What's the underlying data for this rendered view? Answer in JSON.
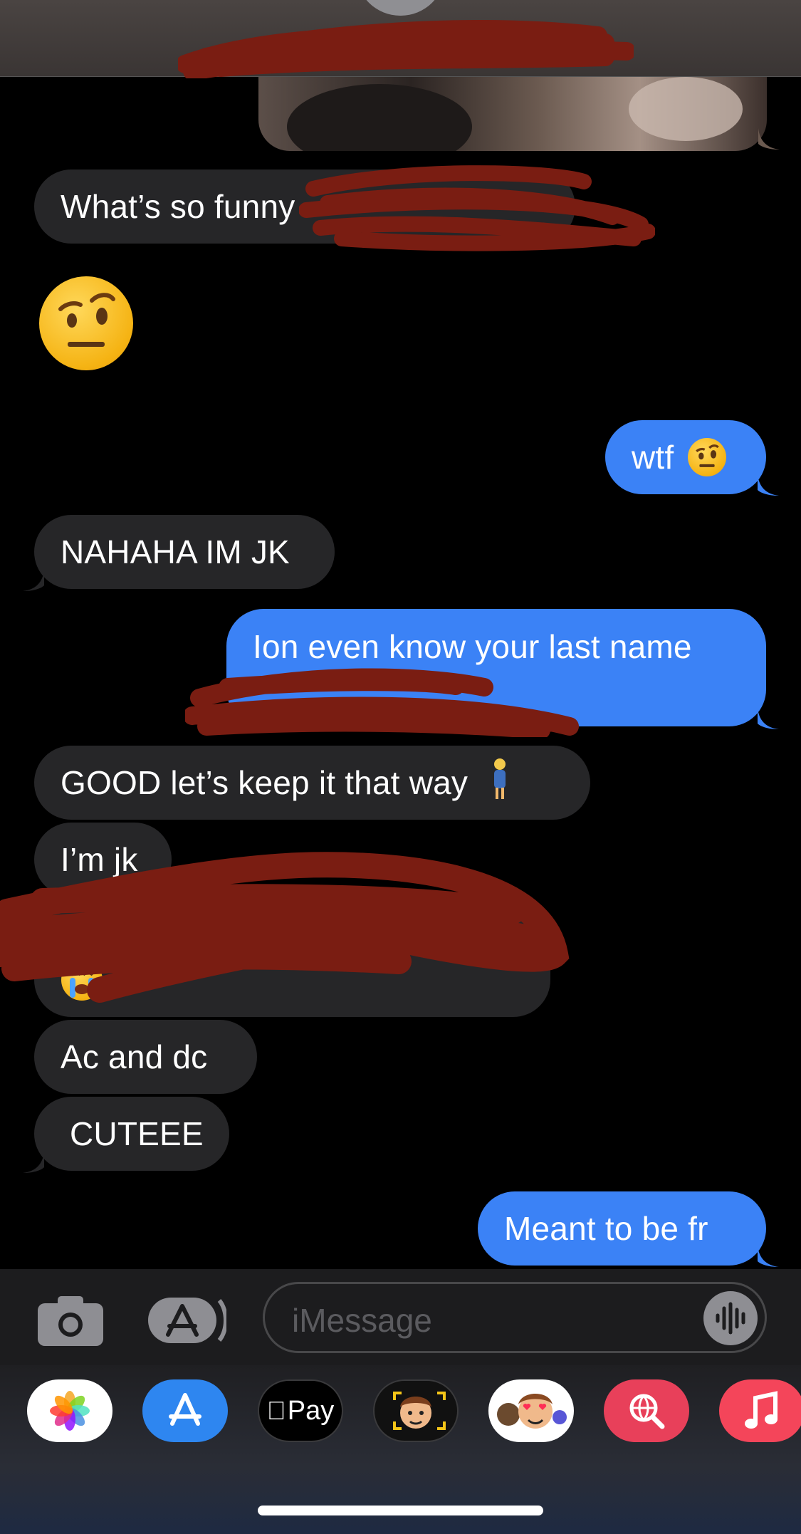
{
  "conversation": {
    "messages": [
      {
        "id": "m1",
        "direction": "incoming",
        "text": "What’s so funny"
      },
      {
        "id": "m3",
        "direction": "outgoing",
        "text": "wtf"
      },
      {
        "id": "m4",
        "direction": "incoming",
        "text": "NAHAHA IM JK"
      },
      {
        "id": "m5",
        "direction": "outgoing",
        "text": "Ion even know your last name"
      },
      {
        "id": "m6",
        "direction": "incoming",
        "text": "GOOD let’s keep it that way"
      },
      {
        "id": "m7",
        "direction": "incoming",
        "text": "I’m jk"
      },
      {
        "id": "m9",
        "direction": "incoming",
        "text": "Ac and dc"
      },
      {
        "id": "m10",
        "direction": "incoming",
        "text": "CUTEEE"
      },
      {
        "id": "m11",
        "direction": "outgoing",
        "text": "Meant to be fr"
      }
    ]
  },
  "icons": {
    "raised_eyebrow_emoji": "face-with-raised-eyebrow",
    "person_emoji": "woman-standing",
    "crying_emoji": "loudly-crying-face"
  },
  "composer": {
    "placeholder": "iMessage",
    "camera_icon": "camera-icon",
    "apps_icon": "app-store-icon",
    "audio_icon": "waveform-icon"
  },
  "app_strip": {
    "items": [
      {
        "name": "photos",
        "icon": "photos-icon"
      },
      {
        "name": "app-store",
        "icon": "app-store-icon"
      },
      {
        "name": "apple-pay",
        "label": "Pay"
      },
      {
        "name": "memoji-stickers",
        "icon": "memoji-icon"
      },
      {
        "name": "animoji",
        "icon": "memoji-hearts-icon"
      },
      {
        "name": "images-search",
        "icon": "globe-search-icon"
      },
      {
        "name": "music",
        "icon": "music-note-icon"
      }
    ]
  },
  "colors": {
    "incoming": "#262628",
    "outgoing": "#3b82f6",
    "redaction": "#7a1d12"
  }
}
